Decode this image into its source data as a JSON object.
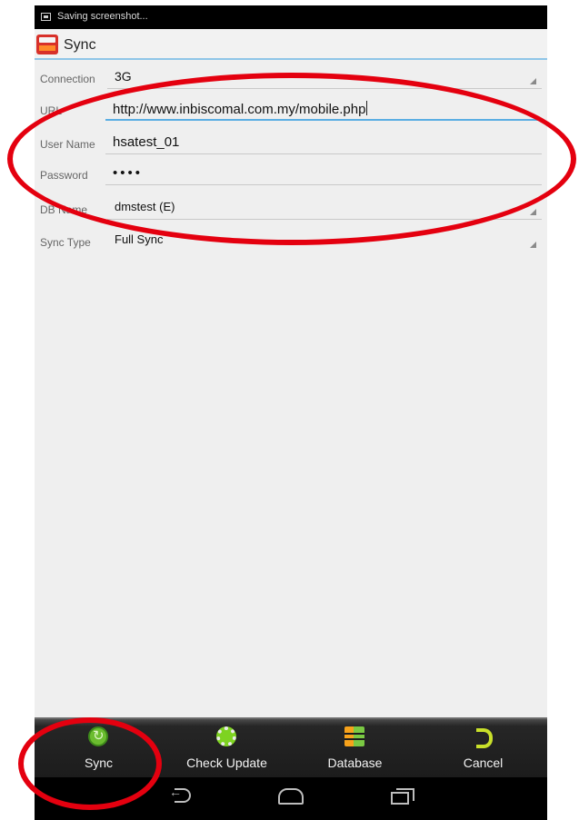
{
  "status_bar": {
    "text": "Saving screenshot..."
  },
  "action_bar": {
    "title": "Sync"
  },
  "form": {
    "connection": {
      "label": "Connection",
      "value": "3G"
    },
    "url": {
      "label": "URL",
      "value": "http://www.inbiscomal.com.my/mobile.php"
    },
    "user_name": {
      "label": "User Name",
      "value": "hsatest_01"
    },
    "password": {
      "label": "Password",
      "value": "••••"
    },
    "db_name": {
      "label": "DB Name",
      "value": "dmstest (E)"
    },
    "sync_type": {
      "label": "Sync Type",
      "value": "Full Sync"
    }
  },
  "toolbar": {
    "sync_label": "Sync",
    "check_update_label": "Check Update",
    "database_label": "Database",
    "cancel_label": "Cancel"
  },
  "colors": {
    "accent_line": "#5aaee3",
    "annotation": "#e4000f",
    "toolbar_bg": "#1c1c1c"
  },
  "icons": [
    "screenshot-icon",
    "app-icon",
    "sync-icon",
    "gear-icon",
    "database-icon",
    "cancel-icon",
    "back-icon",
    "home-icon",
    "recent-apps-icon"
  ]
}
